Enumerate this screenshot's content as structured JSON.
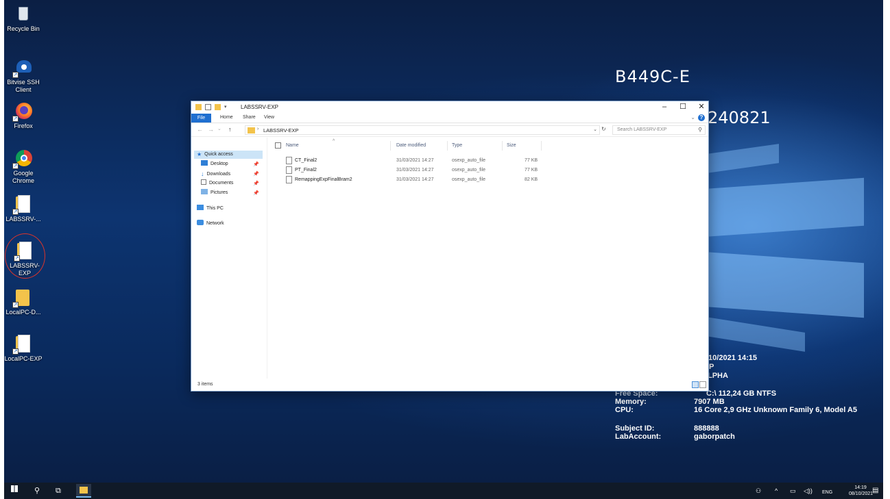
{
  "desktop": {
    "icons": [
      {
        "label": "Recycle Bin",
        "icon": "recycle-bin-icon"
      },
      {
        "label": "Bitvise SSH Client",
        "icon": "bitvise-ssh-icon"
      },
      {
        "label": "Firefox",
        "icon": "firefox-icon"
      },
      {
        "label": "Google Chrome",
        "icon": "chrome-icon"
      },
      {
        "label": "LABSSRV-...",
        "icon": "folder-shortcut-icon"
      },
      {
        "label": "LABSSRV-EXP",
        "icon": "folder-shortcut-icon"
      },
      {
        "label": "LocalPC-D...",
        "icon": "folder-shortcut-icon"
      },
      {
        "label": "LocalPC-EXP",
        "icon": "folder-shortcut-icon"
      }
    ],
    "highlight_color": "#d9342b"
  },
  "info_panel": {
    "hostname": "B449C-E",
    "lab_id": "240821",
    "boot_time_partial": "/10/2021 14:15",
    "line_p": "P",
    "line_pha": "LPHA",
    "labels": {
      "free_space": "Free Space:",
      "memory": "Memory:",
      "cpu": "CPU:",
      "subject_id": "Subject ID:",
      "lab_account": "LabAccount:"
    },
    "values": {
      "free_space": "C:\\ 112,24 GB NTFS",
      "memory": "7907 MB",
      "cpu": "16 Core 2,9 GHz Unknown Family 6, Model A5",
      "subject_id": "888888",
      "lab_account": "gaborpatch"
    }
  },
  "explorer": {
    "title": "LABSSRV-EXP",
    "ribbon_tabs": [
      "File",
      "Home",
      "Share",
      "View"
    ],
    "address": "LABSSRV-EXP",
    "search_placeholder": "Search LABSSRV-EXP",
    "nav": {
      "quick_access": "Quick access",
      "desktop": "Desktop",
      "downloads": "Downloads",
      "documents": "Documents",
      "pictures": "Pictures",
      "this_pc": "This PC",
      "network": "Network"
    },
    "columns": {
      "name": "Name",
      "date": "Date modified",
      "type": "Type",
      "size": "Size"
    },
    "files": [
      {
        "name": "CT_Final2",
        "date": "31/03/2021 14:27",
        "type": "osexp_auto_file",
        "size": "77 KB"
      },
      {
        "name": "PT_Final2",
        "date": "31/03/2021 14:27",
        "type": "osexp_auto_file",
        "size": "77 KB"
      },
      {
        "name": "RemappingExpFinalBram2",
        "date": "31/03/2021 14:27",
        "type": "osexp_auto_file",
        "size": "82 KB"
      }
    ],
    "status": "3 items",
    "accent": "#1f6fd0"
  },
  "taskbar": {
    "time": "14:19",
    "date": "08/10/2021",
    "language": "ENG"
  }
}
